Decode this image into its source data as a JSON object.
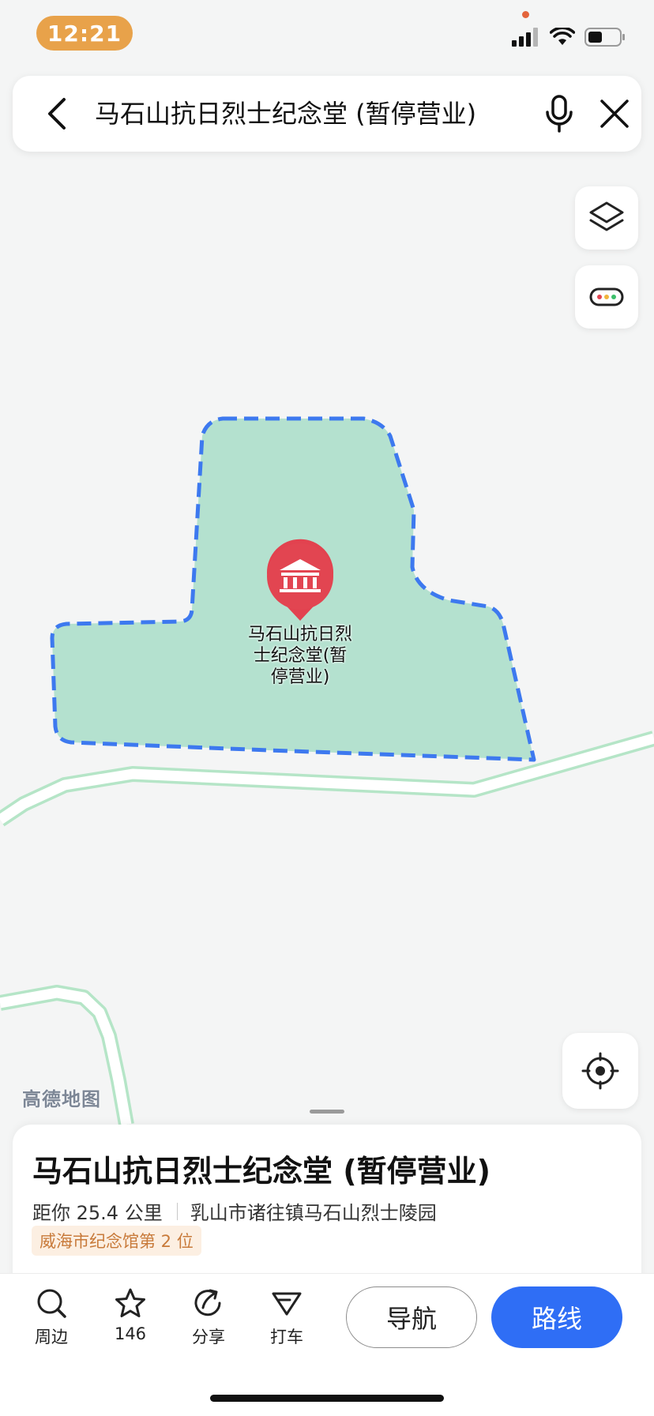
{
  "status_bar": {
    "time": "12:21"
  },
  "search": {
    "query": "马石山抗日烈士纪念堂 (暂停营业)"
  },
  "map": {
    "poi_label": [
      "马石山抗日烈",
      "士纪念堂(暂",
      "停营业)"
    ],
    "watermark": "高德地图"
  },
  "place": {
    "name": "马石山抗日烈士纪念堂 (暂停营业)",
    "distance": "距你 25.4 公里",
    "address": "乳山市诸往镇马石山烈士陵园",
    "rank_tag": "威海市纪念馆第 2 位"
  },
  "actions": {
    "nearby": "周边",
    "favorites_count": "146",
    "share": "分享",
    "taxi": "打车",
    "navigate": "导航",
    "route": "路线"
  },
  "colors": {
    "area_fill": "#b4e1cf",
    "area_border": "#3d79ef",
    "road": "#b5e5c7",
    "pin": "#e2424f",
    "primary": "#2f6ef5",
    "time_pill": "#e8a24a"
  }
}
